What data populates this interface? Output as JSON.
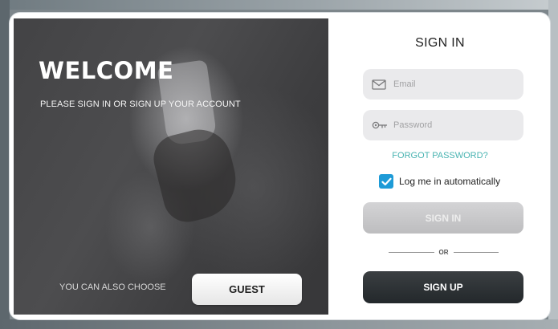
{
  "welcome": {
    "title": "WELCOME",
    "subtitle": "PLEASE SIGN IN OR SIGN UP YOUR ACCOUNT",
    "also_choose": "YOU CAN ALSO CHOOSE",
    "guest_label": "GUEST"
  },
  "signin": {
    "title": "SIGN IN",
    "email_placeholder": "Email",
    "password_placeholder": "Password",
    "forgot_label": "FORGOT PASSWORD?",
    "remember_label": "Log me in automatically",
    "remember_checked": true,
    "signin_label": "SIGN IN",
    "or_label": "OR",
    "signup_label": "SIGN UP"
  },
  "icons": {
    "email": "envelope-icon",
    "password": "key-icon",
    "checkbox": "checkmark-icon"
  },
  "colors": {
    "accent_teal": "#48b3b1",
    "checkbox_blue": "#1e9bd7",
    "dark_panel": "#3f3f41",
    "signup_dark": "#2b3033"
  }
}
